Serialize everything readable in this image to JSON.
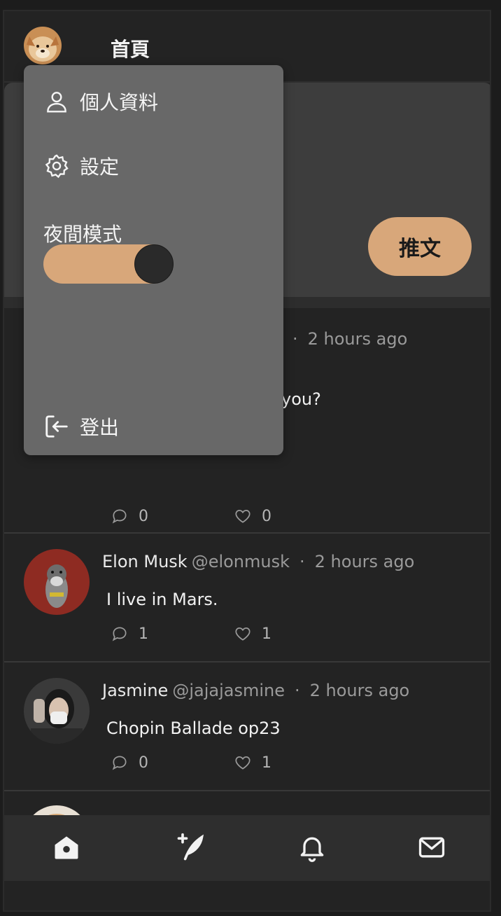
{
  "header": {
    "title": "首頁"
  },
  "compose": {
    "tweet_button": "推文"
  },
  "menu": {
    "profile": "個人資料",
    "settings": "設定",
    "night_mode_label": "夜間模式",
    "night_mode_on": true,
    "logout": "登出"
  },
  "posts": [
    {
      "name": "",
      "handle": "",
      "time": "2 hours ago",
      "content": "you?",
      "replies": "0",
      "likes": "0"
    },
    {
      "name": "Elon Musk",
      "handle": "@elonmusk",
      "time": "2 hours ago",
      "content": "I live in Mars.",
      "replies": "1",
      "likes": "1"
    },
    {
      "name": "Jasmine",
      "handle": "@jajajasmine",
      "time": "2 hours ago",
      "content": "Chopin Ballade op23",
      "replies": "0",
      "likes": "1"
    }
  ],
  "colors": {
    "accent": "#d8a77a",
    "background": "#232323",
    "menu": "#686868"
  },
  "nav": [
    "home-icon",
    "new-tweet-icon",
    "bell-icon",
    "mail-icon"
  ]
}
